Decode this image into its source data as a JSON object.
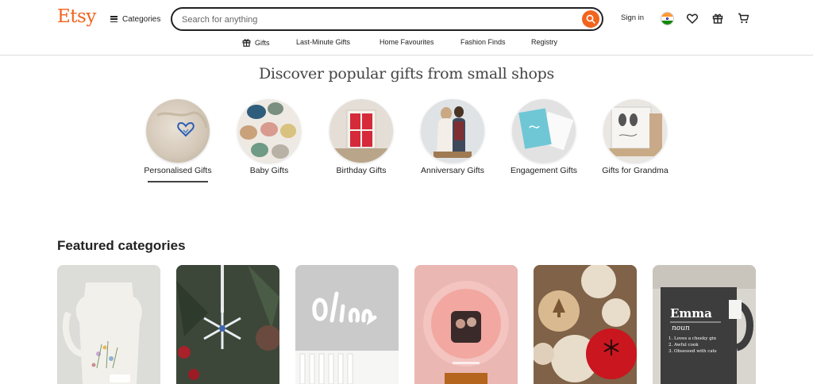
{
  "header": {
    "logo": "Etsy",
    "categories_label": "Categories",
    "search_placeholder": "Search for anything",
    "signin_label": "Sign in"
  },
  "subnav": [
    {
      "label": "Gifts",
      "icon": "gift-icon"
    },
    {
      "label": "Last-Minute Gifts"
    },
    {
      "label": "Home Favourites"
    },
    {
      "label": "Fashion Finds"
    },
    {
      "label": "Registry"
    }
  ],
  "discover": {
    "title": "Discover popular gifts from small shops",
    "items": [
      {
        "label": "Personalised Gifts",
        "selected": true
      },
      {
        "label": "Baby Gifts"
      },
      {
        "label": "Birthday Gifts"
      },
      {
        "label": "Anniversary Gifts"
      },
      {
        "label": "Engagement Gifts"
      },
      {
        "label": "Gifts for Grandma"
      }
    ]
  },
  "featured": {
    "title": "Featured categories"
  },
  "colors": {
    "brand": "#f1641e",
    "text": "#222222"
  }
}
